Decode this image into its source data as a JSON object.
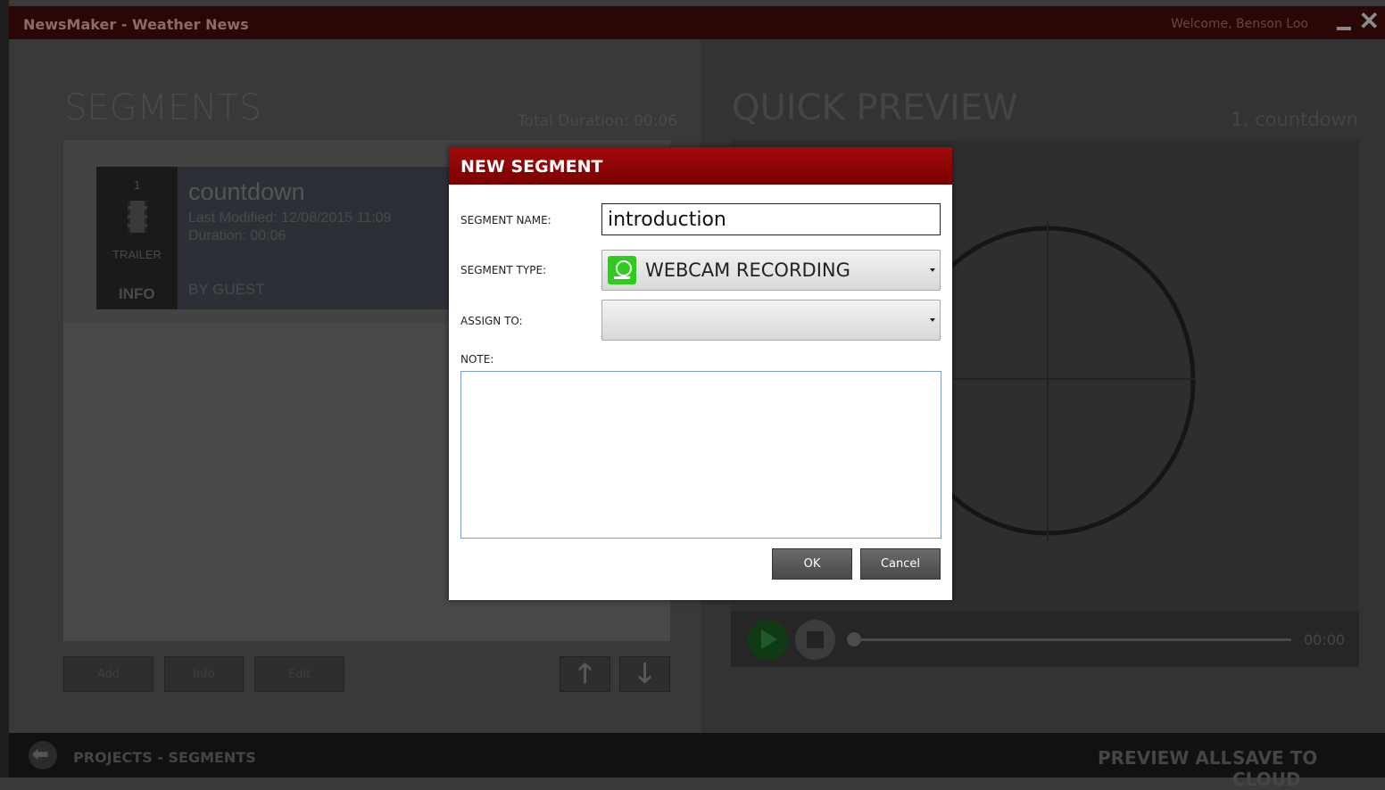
{
  "window": {
    "title": "NewsMaker - Weather News",
    "welcome": "Welcome,  Benson Loo",
    "minimize_icon": "minimize-icon",
    "close_icon": "close-icon",
    "close_glyph": "✕"
  },
  "segments_panel": {
    "heading": "SEGMENTS",
    "total_duration": "Total Duration:  00:06",
    "items": [
      {
        "number": "1",
        "type": "TRAILER",
        "info": "INFO",
        "name": "countdown",
        "last_modified": "Last Modified:  12/08/2015 11:09",
        "duration": "Duration:  00:06",
        "by": "BY  GUEST"
      }
    ],
    "buttons": {
      "add": "Add",
      "info": "Info",
      "edit": "Edit",
      "up_glyph": "🡑",
      "down_glyph": "🡓"
    }
  },
  "preview_panel": {
    "heading": "QUICK PREVIEW",
    "current": "1. countdown",
    "time": "00:00"
  },
  "bottom_bar": {
    "back_glyph": "⬅",
    "breadcrumb": "PROJECTS - SEGMENTS",
    "preview_all": "PREVIEW ALL",
    "save_to_cloud": "SAVE TO CLOUD"
  },
  "dialog": {
    "title": "NEW SEGMENT",
    "segment_name_label": "SEGMENT NAME:",
    "segment_name_value": "introduction",
    "segment_type_label": "SEGMENT TYPE:",
    "segment_type_value": "WEBCAM RECORDING",
    "segment_type_icon": "webcam-icon",
    "assign_to_label": "ASSIGN TO:",
    "assign_to_value": "",
    "note_label": "NOTE:",
    "note_value": "",
    "ok": "OK",
    "cancel": "Cancel",
    "accent_color": "#a20a0a"
  }
}
